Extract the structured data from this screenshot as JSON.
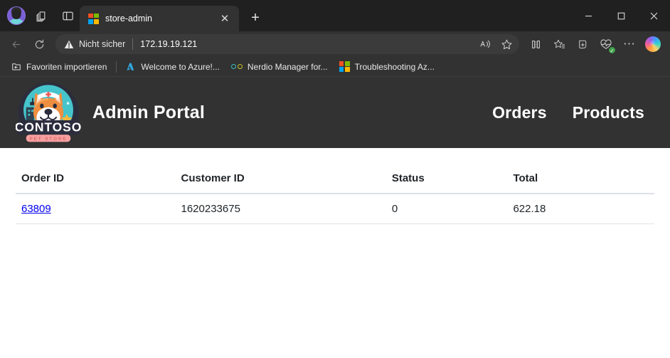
{
  "window": {
    "minimize_label": "—",
    "maximize_label": "☐",
    "close_label": "✕"
  },
  "tabstrip": {
    "profile_name": "profile-avatar",
    "tab_actions_label": "",
    "split_label": "",
    "tab": {
      "title": "store-admin",
      "close_label": "✕",
      "favicon": "microsoft-logo-icon"
    },
    "new_tab_label": "+"
  },
  "toolbar": {
    "back_label": "←",
    "forward_label": "→",
    "refresh_label": "⟳",
    "security_text": "Nicht sicher",
    "url_scheme": "",
    "url_host": "172.19.19.121",
    "read_aloud_label": "A",
    "favorite_label": "☆",
    "split_screen_label": "",
    "collections_label": "",
    "add_favorites_label": "",
    "browser_essentials_label": "",
    "browser_essentials_badge": "✓",
    "settings_label": "⋯",
    "copilot_label": "copilot"
  },
  "bookmarks": {
    "import_label": "Favoriten importieren",
    "items": [
      {
        "label": "Welcome to Azure!...",
        "icon": "azure-icon"
      },
      {
        "label": "Nerdio Manager for...",
        "icon": "nerdio-icon"
      },
      {
        "label": "Troubleshooting Az...",
        "icon": "microsoft-logo-icon"
      }
    ]
  },
  "site": {
    "logo_alt": "Contoso Pet Store",
    "logo_text_main": "CONTOSO",
    "logo_text_sub": "PET STORE",
    "title": "Admin Portal",
    "nav": [
      {
        "label": "Orders",
        "name": "nav-link-orders"
      },
      {
        "label": "Products",
        "name": "nav-link-products"
      }
    ]
  },
  "orders_table": {
    "columns": [
      "Order ID",
      "Customer ID",
      "Status",
      "Total"
    ],
    "rows": [
      {
        "order_id": "63809",
        "customer_id": "1620233675",
        "status": "0",
        "total": "622.18"
      }
    ]
  },
  "colors": {
    "chrome_dark": "#202020",
    "chrome_toolbar": "#323232",
    "page_bg": "#ffffff",
    "link_blue": "#0000ee",
    "table_border": "#dee2e6",
    "accent_teal": "#4fd1d1",
    "accent_orange": "#f08a3c"
  }
}
